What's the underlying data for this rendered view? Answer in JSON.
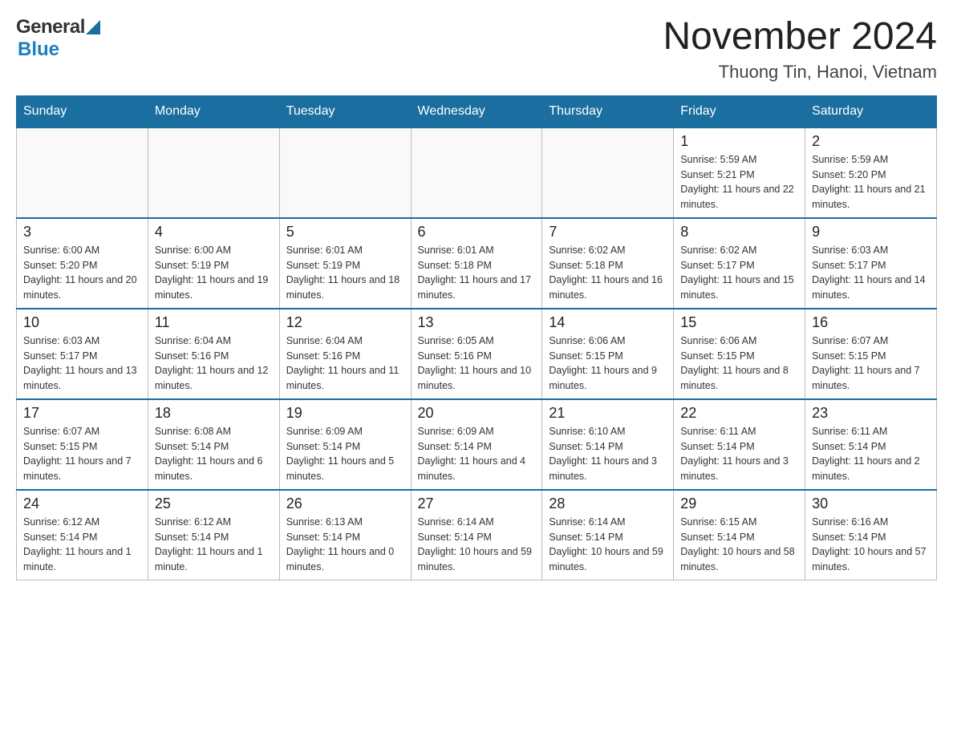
{
  "header": {
    "logo": {
      "general": "General",
      "blue": "Blue"
    },
    "title": "November 2024",
    "location": "Thuong Tin, Hanoi, Vietnam"
  },
  "weekdays": [
    "Sunday",
    "Monday",
    "Tuesday",
    "Wednesday",
    "Thursday",
    "Friday",
    "Saturday"
  ],
  "weeks": [
    [
      {
        "day": "",
        "info": ""
      },
      {
        "day": "",
        "info": ""
      },
      {
        "day": "",
        "info": ""
      },
      {
        "day": "",
        "info": ""
      },
      {
        "day": "",
        "info": ""
      },
      {
        "day": "1",
        "info": "Sunrise: 5:59 AM\nSunset: 5:21 PM\nDaylight: 11 hours and 22 minutes."
      },
      {
        "day": "2",
        "info": "Sunrise: 5:59 AM\nSunset: 5:20 PM\nDaylight: 11 hours and 21 minutes."
      }
    ],
    [
      {
        "day": "3",
        "info": "Sunrise: 6:00 AM\nSunset: 5:20 PM\nDaylight: 11 hours and 20 minutes."
      },
      {
        "day": "4",
        "info": "Sunrise: 6:00 AM\nSunset: 5:19 PM\nDaylight: 11 hours and 19 minutes."
      },
      {
        "day": "5",
        "info": "Sunrise: 6:01 AM\nSunset: 5:19 PM\nDaylight: 11 hours and 18 minutes."
      },
      {
        "day": "6",
        "info": "Sunrise: 6:01 AM\nSunset: 5:18 PM\nDaylight: 11 hours and 17 minutes."
      },
      {
        "day": "7",
        "info": "Sunrise: 6:02 AM\nSunset: 5:18 PM\nDaylight: 11 hours and 16 minutes."
      },
      {
        "day": "8",
        "info": "Sunrise: 6:02 AM\nSunset: 5:17 PM\nDaylight: 11 hours and 15 minutes."
      },
      {
        "day": "9",
        "info": "Sunrise: 6:03 AM\nSunset: 5:17 PM\nDaylight: 11 hours and 14 minutes."
      }
    ],
    [
      {
        "day": "10",
        "info": "Sunrise: 6:03 AM\nSunset: 5:17 PM\nDaylight: 11 hours and 13 minutes."
      },
      {
        "day": "11",
        "info": "Sunrise: 6:04 AM\nSunset: 5:16 PM\nDaylight: 11 hours and 12 minutes."
      },
      {
        "day": "12",
        "info": "Sunrise: 6:04 AM\nSunset: 5:16 PM\nDaylight: 11 hours and 11 minutes."
      },
      {
        "day": "13",
        "info": "Sunrise: 6:05 AM\nSunset: 5:16 PM\nDaylight: 11 hours and 10 minutes."
      },
      {
        "day": "14",
        "info": "Sunrise: 6:06 AM\nSunset: 5:15 PM\nDaylight: 11 hours and 9 minutes."
      },
      {
        "day": "15",
        "info": "Sunrise: 6:06 AM\nSunset: 5:15 PM\nDaylight: 11 hours and 8 minutes."
      },
      {
        "day": "16",
        "info": "Sunrise: 6:07 AM\nSunset: 5:15 PM\nDaylight: 11 hours and 7 minutes."
      }
    ],
    [
      {
        "day": "17",
        "info": "Sunrise: 6:07 AM\nSunset: 5:15 PM\nDaylight: 11 hours and 7 minutes."
      },
      {
        "day": "18",
        "info": "Sunrise: 6:08 AM\nSunset: 5:14 PM\nDaylight: 11 hours and 6 minutes."
      },
      {
        "day": "19",
        "info": "Sunrise: 6:09 AM\nSunset: 5:14 PM\nDaylight: 11 hours and 5 minutes."
      },
      {
        "day": "20",
        "info": "Sunrise: 6:09 AM\nSunset: 5:14 PM\nDaylight: 11 hours and 4 minutes."
      },
      {
        "day": "21",
        "info": "Sunrise: 6:10 AM\nSunset: 5:14 PM\nDaylight: 11 hours and 3 minutes."
      },
      {
        "day": "22",
        "info": "Sunrise: 6:11 AM\nSunset: 5:14 PM\nDaylight: 11 hours and 3 minutes."
      },
      {
        "day": "23",
        "info": "Sunrise: 6:11 AM\nSunset: 5:14 PM\nDaylight: 11 hours and 2 minutes."
      }
    ],
    [
      {
        "day": "24",
        "info": "Sunrise: 6:12 AM\nSunset: 5:14 PM\nDaylight: 11 hours and 1 minute."
      },
      {
        "day": "25",
        "info": "Sunrise: 6:12 AM\nSunset: 5:14 PM\nDaylight: 11 hours and 1 minute."
      },
      {
        "day": "26",
        "info": "Sunrise: 6:13 AM\nSunset: 5:14 PM\nDaylight: 11 hours and 0 minutes."
      },
      {
        "day": "27",
        "info": "Sunrise: 6:14 AM\nSunset: 5:14 PM\nDaylight: 10 hours and 59 minutes."
      },
      {
        "day": "28",
        "info": "Sunrise: 6:14 AM\nSunset: 5:14 PM\nDaylight: 10 hours and 59 minutes."
      },
      {
        "day": "29",
        "info": "Sunrise: 6:15 AM\nSunset: 5:14 PM\nDaylight: 10 hours and 58 minutes."
      },
      {
        "day": "30",
        "info": "Sunrise: 6:16 AM\nSunset: 5:14 PM\nDaylight: 10 hours and 57 minutes."
      }
    ]
  ]
}
